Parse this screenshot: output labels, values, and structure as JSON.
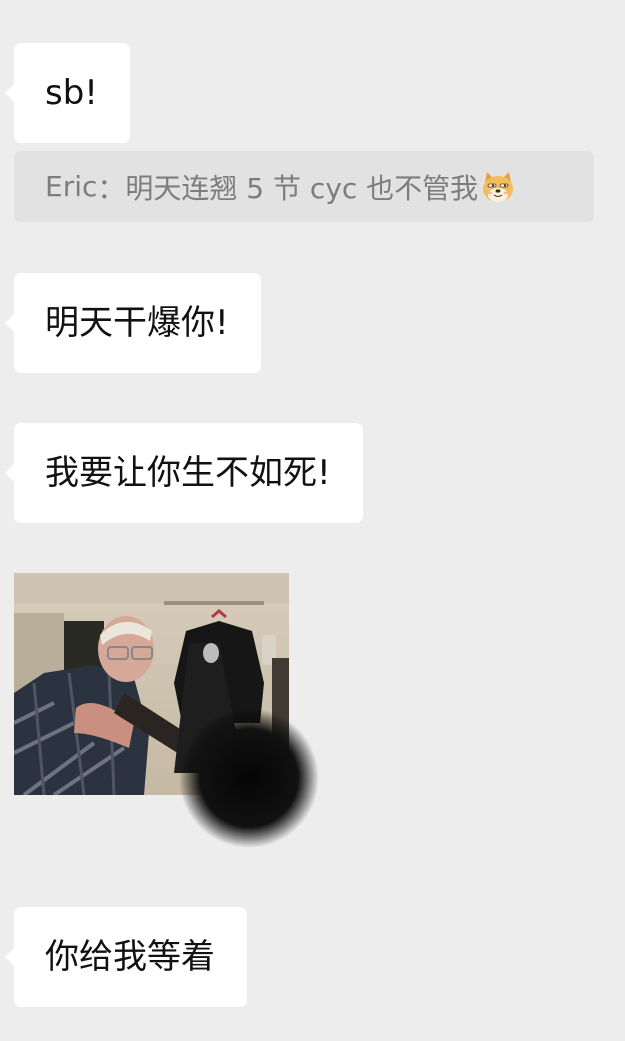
{
  "chat": {
    "messages": [
      {
        "text": "sb!"
      },
      {
        "quote_sender": "Eric",
        "quote_separator": "：",
        "quote_text": "明天连翘 5 节 cyc 也不管我",
        "quote_emoji": "doge-emoji-icon"
      },
      {
        "text": "明天干爆你!"
      },
      {
        "text": "我要让你生不如死!"
      },
      {
        "image": "man-aiming-shotgun-photo"
      },
      {
        "text": "你给我等着"
      }
    ]
  },
  "colors": {
    "background": "#ededed",
    "bubble": "#ffffff",
    "quote_bg": "#e2e2e2",
    "quote_text": "#7d7d7d",
    "text": "#111111"
  }
}
